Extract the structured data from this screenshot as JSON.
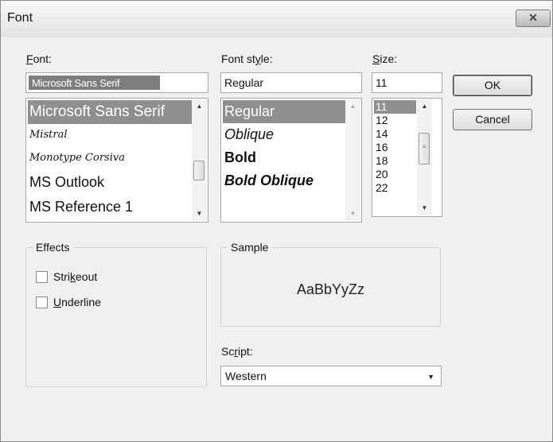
{
  "window": {
    "title": "Font",
    "close_symbol": "✕"
  },
  "font": {
    "label_accel": "F",
    "label_rest": "ont:",
    "value": "Microsoft Sans Serif",
    "items": [
      "Microsoft Sans Serif",
      "Mistral",
      "Monotype Corsiva",
      "MS Outlook",
      "MS Reference 1"
    ],
    "selected_index": 0
  },
  "style": {
    "label_pre": "Font st",
    "label_accel": "y",
    "label_post": "le:",
    "value": "Regular",
    "items": [
      "Regular",
      "Oblique",
      "Bold",
      "Bold Oblique"
    ],
    "selected_index": 0
  },
  "size": {
    "label_accel": "S",
    "label_rest": "ize:",
    "value": "11",
    "items": [
      "11",
      "12",
      "14",
      "16",
      "18",
      "20",
      "22"
    ],
    "selected_index": 0
  },
  "buttons": {
    "ok": "OK",
    "cancel": "Cancel"
  },
  "effects": {
    "title": "Effects",
    "strikeout_pre": "Stri",
    "strikeout_accel": "k",
    "strikeout_post": "eout",
    "strikeout_checked": false,
    "underline_accel": "U",
    "underline_post": "nderline",
    "underline_checked": false
  },
  "sample": {
    "title": "Sample",
    "text": "AaBbYyZz"
  },
  "script": {
    "label_pre": "Sc",
    "label_accel": "r",
    "label_post": "ipt:",
    "value": "Western"
  }
}
